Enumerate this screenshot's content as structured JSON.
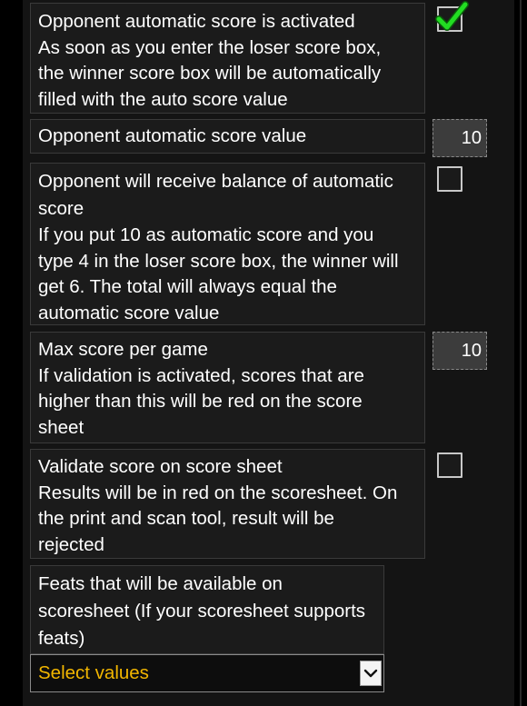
{
  "settings": {
    "auto_score_activated": {
      "title": "Opponent automatic score is activated",
      "description": [
        "As soon as you enter the loser score box,",
        "the winner score box will be automatically",
        "filled with the auto score value"
      ],
      "checked": true
    },
    "auto_score_value": {
      "title": "Opponent automatic score value",
      "value": "10"
    },
    "balance_auto_score": {
      "title": [
        "Opponent will receive balance of automatic",
        "score"
      ],
      "description": [
        "If you put 10 as automatic score and you",
        "type 4 in the loser score box, the winner will",
        "get 6. The total will always equal the",
        "automatic score value"
      ],
      "checked": false
    },
    "max_score": {
      "title": "Max score per game",
      "description": [
        "If validation is activated, scores that are",
        "higher than this will be red on the score",
        "sheet"
      ],
      "value": "10"
    },
    "validate_score": {
      "title": "Validate score on score sheet",
      "description": [
        "Results will be in red on the scoresheet. On",
        "the print and scan tool, result will be",
        "rejected"
      ],
      "checked": false
    },
    "feats": {
      "title": [
        "Feats that will be available on",
        "scoresheet (If your scoresheet supports",
        "feats)"
      ],
      "select_placeholder": "Select values"
    }
  },
  "colors": {
    "background": "#000000",
    "panel": "#141414",
    "label_box": "#1b1b1b",
    "checkmark": "#22dd22",
    "select_text": "#f2b600"
  }
}
